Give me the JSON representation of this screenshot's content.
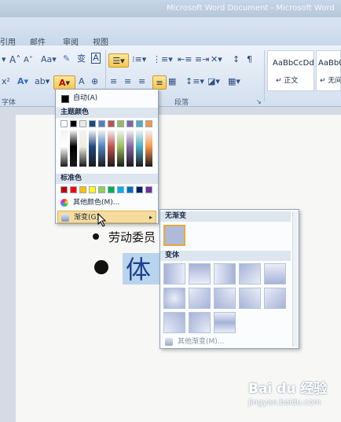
{
  "window": {
    "title": "Microsoft Word Document - Microsoft Word"
  },
  "tabs": [
    {
      "label": "引用"
    },
    {
      "label": "邮件"
    },
    {
      "label": "审阅"
    },
    {
      "label": "视图"
    }
  ],
  "ribbon": {
    "groups": {
      "font_label": "字体",
      "paragraph_label": "段落"
    },
    "styles": [
      {
        "sample": "AaBbCcDd",
        "name": "↵ 正文"
      },
      {
        "sample": "AaBbC",
        "name": "↵ 无间"
      }
    ]
  },
  "color_menu": {
    "auto_label": "自动(A)",
    "theme_colors_label": "主题颜色",
    "standard_colors_label": "标准色",
    "more_colors_label": "其他颜色(M)...",
    "gradient_label": "渐变(G)",
    "theme_top_row": [
      "#ffffff",
      "#000000",
      "#eeece1",
      "#1f497d",
      "#4f81bd",
      "#c0504d",
      "#9bbb59",
      "#8064a2",
      "#4bacc6",
      "#f79646"
    ],
    "standard_row": [
      "#c00000",
      "#ff0000",
      "#ffc000",
      "#ffff00",
      "#92d050",
      "#00b050",
      "#00b0f0",
      "#0070c0",
      "#002060",
      "#7030a0"
    ]
  },
  "gradient_menu": {
    "no_gradient_label": "无渐变",
    "variants_label": "变体",
    "more_gradients_label": "其他渐变(M)..."
  },
  "document": {
    "line1": "劳动委员",
    "line2": "体"
  },
  "watermark": {
    "brand": "Bai du 经验",
    "url": "jingyan.baidu.com"
  }
}
